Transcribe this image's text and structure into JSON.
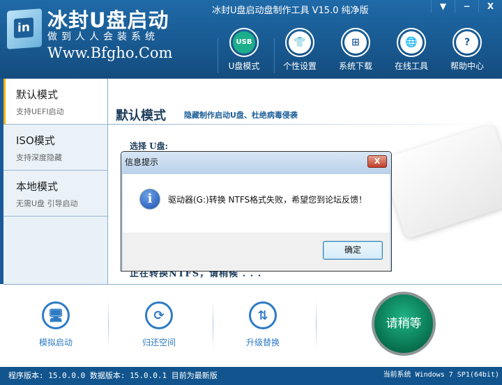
{
  "header": {
    "logo_icon": "in",
    "brand": "冰封U盘启动",
    "slogan": "做到人人会装系统",
    "site": "Www.Bfgho.Com",
    "title": "冰封U盘启动盘制作工具 V15.0 纯净版",
    "window_buttons": [
      "▼",
      "−",
      "X"
    ],
    "nav": [
      {
        "label": "U盘模式",
        "icon": "USB"
      },
      {
        "label": "个性设置",
        "icon": "👕"
      },
      {
        "label": "系统下载",
        "icon": "⊞"
      },
      {
        "label": "在线工具",
        "icon": "🌐"
      },
      {
        "label": "帮助中心",
        "icon": "?"
      }
    ]
  },
  "sidebar": {
    "items": [
      {
        "title": "默认模式",
        "sub": "支持UEFI启动"
      },
      {
        "title": "ISO模式",
        "sub": "支持深度隐藏"
      },
      {
        "title": "本地模式",
        "sub": "无需U盘 引导启动"
      }
    ]
  },
  "main": {
    "title": "默认模式",
    "subtitle": "隐藏制作启动U盘、杜绝病毒侵袭",
    "select_label": "选择 U盘:",
    "progress_text": "正在转换NTFS，请稍候 . . ."
  },
  "tools": [
    {
      "label": "模拟启动",
      "icon": "🖥"
    },
    {
      "label": "归还空间",
      "icon": "⟳"
    },
    {
      "label": "升级替换",
      "icon": "⇅"
    }
  ],
  "wait_button": "请稍等",
  "status": {
    "left": "程序版本: 15.0.0.0 数据版本: 15.0.0.1 目前为最新版",
    "right": "当前系统 Windows 7 SP1(64bit)"
  },
  "dialog": {
    "title": "信息提示",
    "close": "X",
    "icon": "i",
    "message": "驱动器(G:)转换 NTFS格式失败，希望您到论坛反馈！",
    "ok": "确定"
  }
}
